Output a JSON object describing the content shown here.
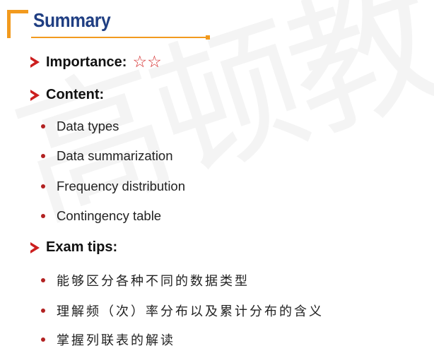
{
  "watermark": "高顿教",
  "slide": {
    "title": "Summary",
    "importance": {
      "label": "Importance:",
      "stars": "☆☆"
    },
    "content": {
      "label": "Content:",
      "items": [
        "Data types",
        "Data summarization",
        "Frequency distribution",
        "Contingency table"
      ]
    },
    "exam_tips": {
      "label": "Exam tips:",
      "items": [
        "能够区分各种不同的数据类型",
        "理解频（次）率分布以及累计分布的含义",
        "掌握列联表的解读"
      ]
    }
  },
  "colors": {
    "accent": "#f29a1e",
    "title": "#1f3e82",
    "arrow": "#cc1f1f",
    "star": "#d42a2a",
    "bullet": "#b22222"
  }
}
